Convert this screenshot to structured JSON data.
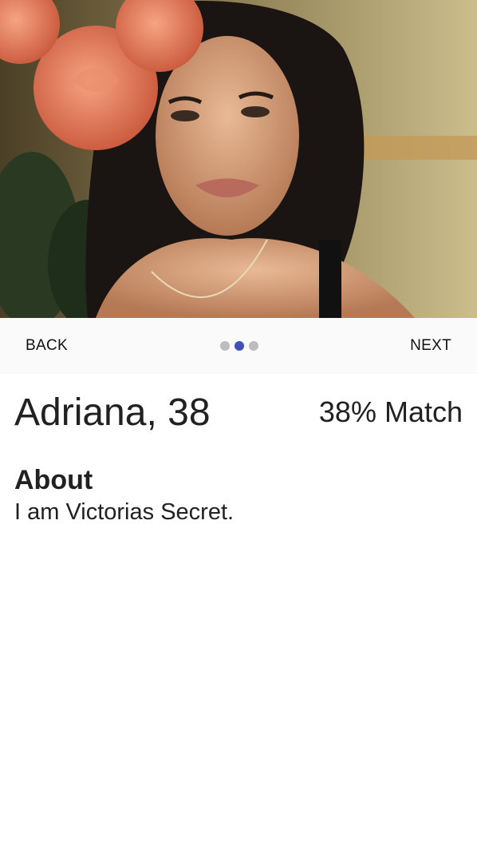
{
  "profile": {
    "photo_alt": "profile photo",
    "name_age": "Adriana, 38",
    "match": "38% Match"
  },
  "stepper": {
    "back_label": "BACK",
    "next_label": "NEXT",
    "total_steps": 3,
    "active_step": 2
  },
  "about": {
    "title": "About",
    "text": "I am Victorias Secret."
  },
  "colors": {
    "accent": "#3f51b5",
    "dot_inactive": "#bdbdbd",
    "stepper_bg": "#fafafa"
  }
}
